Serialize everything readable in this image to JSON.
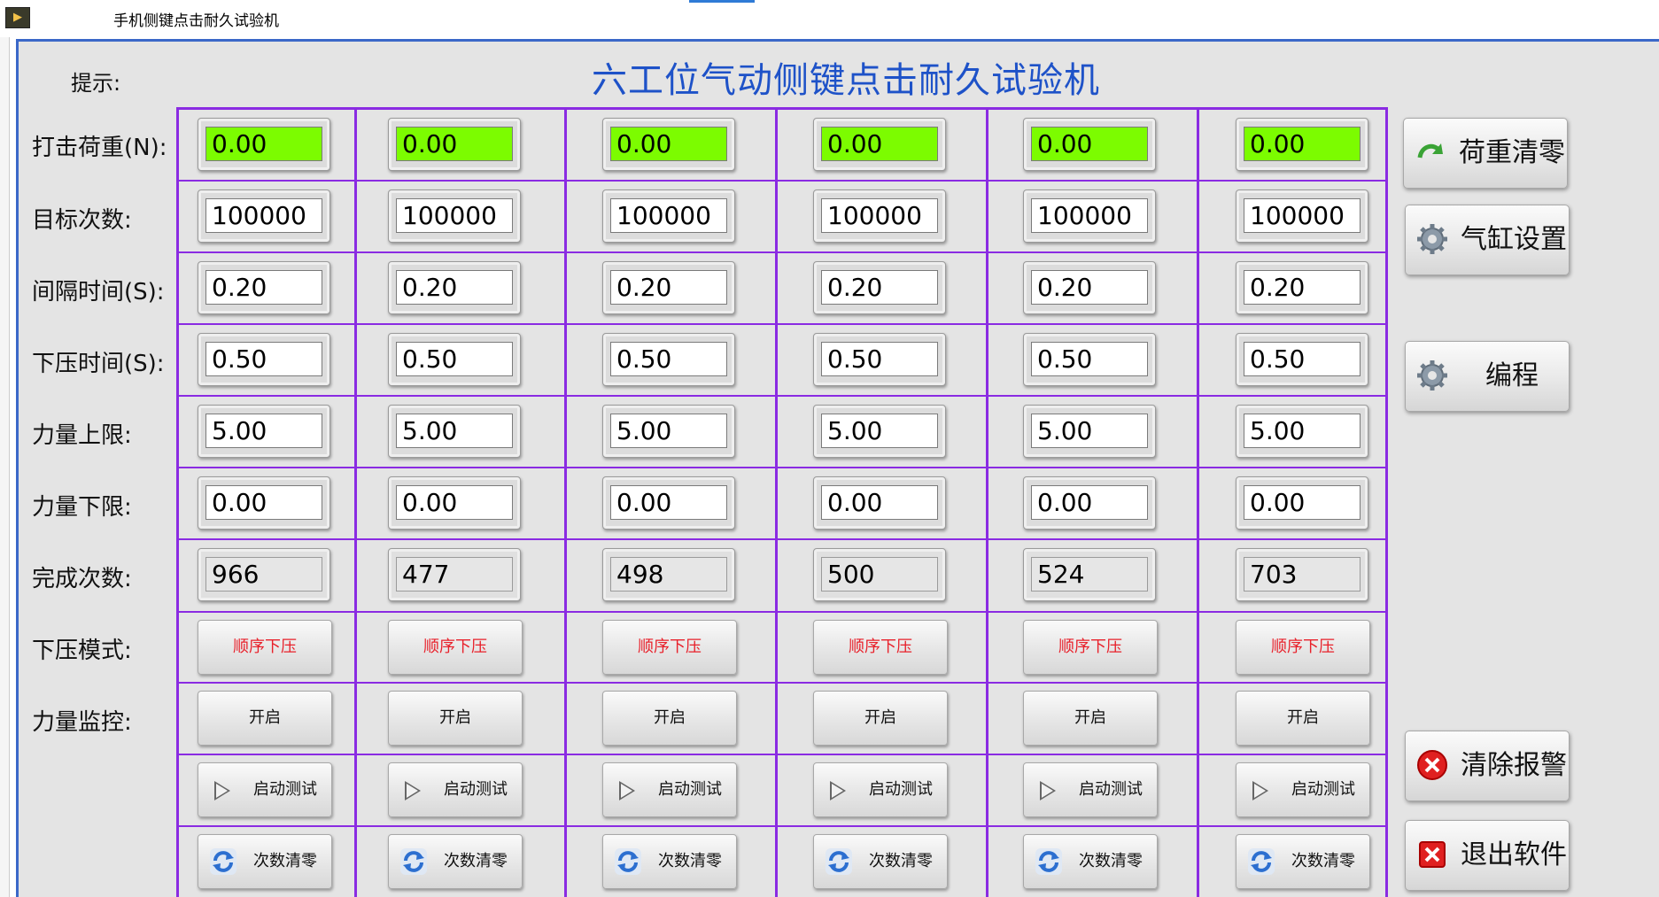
{
  "window": {
    "title": "手机侧键点击耐久试验机"
  },
  "header": {
    "hint_label": "提示:",
    "main_title": "六工位气动侧键点击耐久试验机"
  },
  "rows": {
    "load": "打击荷重(N):",
    "target": "目标次数:",
    "interval": "间隔时间(S):",
    "press_time": "下压时间(S):",
    "upper": "力量上限:",
    "lower": "力量下限:",
    "done": "完成次数:",
    "mode": "下压模式:",
    "monitor": "力量监控:"
  },
  "stations": [
    {
      "load": "0.00",
      "target": "100000",
      "interval": "0.20",
      "press_time": "0.50",
      "upper": "5.00",
      "lower": "0.00",
      "done": "966",
      "mode": "顺序下压",
      "monitor": "开启",
      "start": "启动测试",
      "reset": "次数清零"
    },
    {
      "load": "0.00",
      "target": "100000",
      "interval": "0.20",
      "press_time": "0.50",
      "upper": "5.00",
      "lower": "0.00",
      "done": "477",
      "mode": "顺序下压",
      "monitor": "开启",
      "start": "启动测试",
      "reset": "次数清零"
    },
    {
      "load": "0.00",
      "target": "100000",
      "interval": "0.20",
      "press_time": "0.50",
      "upper": "5.00",
      "lower": "0.00",
      "done": "498",
      "mode": "顺序下压",
      "monitor": "开启",
      "start": "启动测试",
      "reset": "次数清零"
    },
    {
      "load": "0.00",
      "target": "100000",
      "interval": "0.20",
      "press_time": "0.50",
      "upper": "5.00",
      "lower": "0.00",
      "done": "500",
      "mode": "顺序下压",
      "monitor": "开启",
      "start": "启动测试",
      "reset": "次数清零"
    },
    {
      "load": "0.00",
      "target": "100000",
      "interval": "0.20",
      "press_time": "0.50",
      "upper": "5.00",
      "lower": "0.00",
      "done": "524",
      "mode": "顺序下压",
      "monitor": "开启",
      "start": "启动测试",
      "reset": "次数清零"
    },
    {
      "load": "0.00",
      "target": "100000",
      "interval": "0.20",
      "press_time": "0.50",
      "upper": "5.00",
      "lower": "0.00",
      "done": "703",
      "mode": "顺序下压",
      "monitor": "开启",
      "start": "启动测试",
      "reset": "次数清零"
    }
  ],
  "side_buttons": {
    "zero_load": "荷重清零",
    "cylinder": "气缸设置",
    "program": "编程",
    "clear_alarm": "清除报警",
    "exit": "退出软件"
  },
  "colors": {
    "title_blue": "#1e52c8",
    "grid_purple": "#8a2be2",
    "load_green": "#7cfc00",
    "mode_red": "#e8202a"
  }
}
